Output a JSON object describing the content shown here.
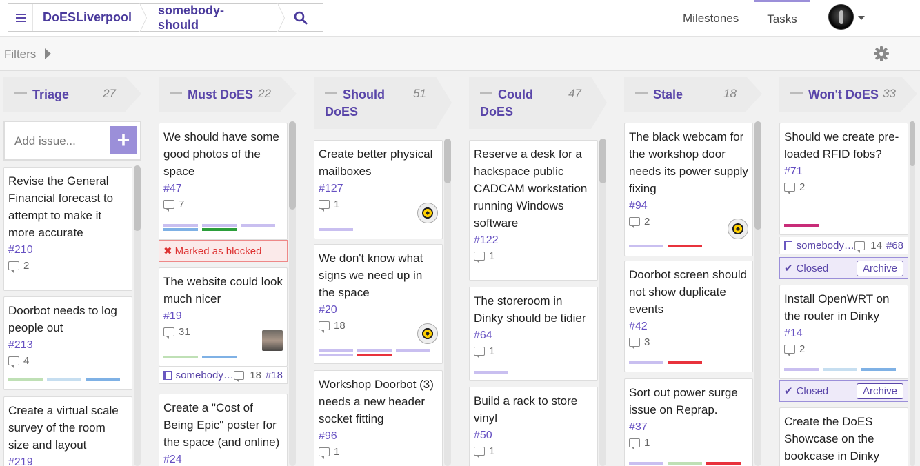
{
  "breadcrumb": {
    "org": "DoESLiverpool",
    "repo": "somebody-should"
  },
  "nav": {
    "milestones": "Milestones",
    "tasks": "Tasks"
  },
  "filters": {
    "label": "Filters"
  },
  "icons": {
    "menu": "hamburger-icon",
    "search": "search-icon",
    "settings": "gear-icon",
    "comments": "comment-icon",
    "repo": "book-icon",
    "closed": "check-icon",
    "blocked": "x-icon"
  },
  "colors": {
    "accent": "#5a46a9",
    "light_purple": "#c9bff0",
    "green": "#2c9e3b",
    "light_green": "#bfe0b5",
    "light_blue": "#c6def0",
    "blue": "#7fb1e5",
    "red": "#e8323c",
    "magenta": "#c82c78"
  },
  "add_issue": {
    "placeholder": "Add issue...",
    "button": "+"
  },
  "columns": [
    {
      "title": "Triage",
      "count": "27",
      "cards": [
        {
          "title": "Revise the General Financial forecast to attempt to make it more accurate",
          "number": "#210",
          "comments": "2"
        },
        {
          "title": "Doorbot needs to log people out",
          "number": "#213",
          "comments": "4"
        },
        {
          "title": "Create a virtual scale survey of the room size and layout",
          "number": "#219"
        }
      ]
    },
    {
      "title": "Must DoES",
      "count": "22",
      "cards": [
        {
          "title": "We should have some good photos of the space",
          "number": "#47",
          "comments": "7",
          "blocked": "Marked as blocked"
        },
        {
          "title": "The website could look much nicer",
          "number": "#19",
          "comments": "31",
          "linked": {
            "repo": "somebody-should",
            "comments": "18",
            "number": "#18"
          }
        },
        {
          "title": "Create a \"Cost of Being Epic\" poster for the space (and online)",
          "number": "#24"
        }
      ]
    },
    {
      "title": "Should DoES",
      "count": "51",
      "cards": [
        {
          "title": "Create better physical mailboxes",
          "number": "#127",
          "comments": "1"
        },
        {
          "title": "We don't know what signs we need up in the space",
          "number": "#20",
          "comments": "18"
        },
        {
          "title": "Workshop Doorbot (3) needs a new header socket fitting",
          "number": "#96",
          "comments": "1"
        }
      ]
    },
    {
      "title": "Could DoES",
      "count": "47",
      "cards": [
        {
          "title": "Reserve a desk for a hackspace public CADCAM workstation running Windows software",
          "number": "#122",
          "comments": "1"
        },
        {
          "title": "The storeroom in Dinky should be tidier",
          "number": "#64",
          "comments": "1"
        },
        {
          "title": "Build a rack to store vinyl",
          "number": "#50",
          "comments": "1"
        }
      ]
    },
    {
      "title": "Stale",
      "count": "18",
      "cards": [
        {
          "title": "The black webcam for the workshop door needs its power supply fixing",
          "number": "#94",
          "comments": "2"
        },
        {
          "title": "Doorbot screen should not show duplicate events",
          "number": "#42",
          "comments": "3"
        },
        {
          "title": "Sort out power surge issue on Reprap.",
          "number": "#37",
          "comments": "1"
        }
      ]
    },
    {
      "title": "Won't DoES",
      "count": "33",
      "cards": [
        {
          "title": "Should we create pre-loaded RFID fobs?",
          "number": "#71",
          "comments": "2",
          "linked": {
            "repo": "somebody-should",
            "comments": "14",
            "number": "#68"
          },
          "closed": "Closed",
          "archive": "Archive"
        },
        {
          "title": "Install OpenWRT on the router in Dinky",
          "number": "#14",
          "comments": "2",
          "closed": "Closed",
          "archive": "Archive"
        },
        {
          "title": "Create the DoES Showcase on the bookcase in Dinky"
        }
      ]
    }
  ]
}
